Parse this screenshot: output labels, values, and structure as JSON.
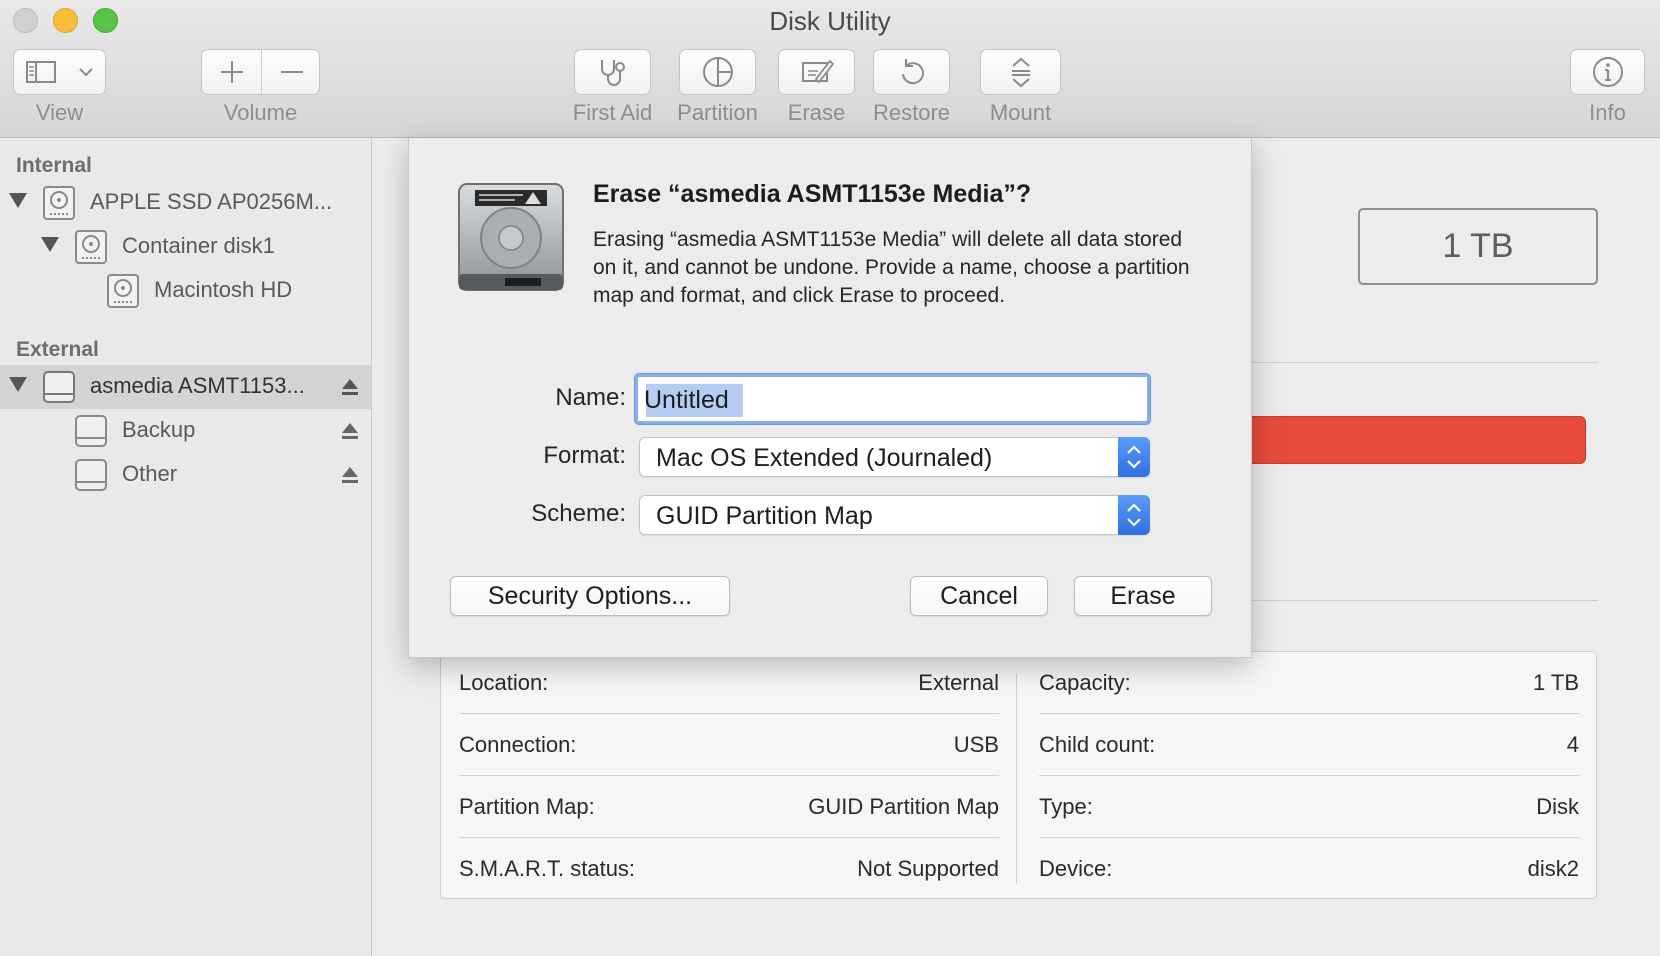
{
  "window": {
    "title": "Disk Utility"
  },
  "toolbar": {
    "view_label": "View",
    "volume_label": "Volume",
    "first_aid_label": "First Aid",
    "partition_label": "Partition",
    "erase_label": "Erase",
    "restore_label": "Restore",
    "mount_label": "Mount",
    "info_label": "Info"
  },
  "sidebar": {
    "internal_heading": "Internal",
    "external_heading": "External",
    "internal_items": [
      {
        "label": "APPLE SSD AP0256M...",
        "icon": "internal-disk-icon"
      },
      {
        "label": "Container disk1",
        "icon": "container-icon"
      },
      {
        "label": "Macintosh HD",
        "icon": "volume-icon"
      }
    ],
    "external_items": [
      {
        "label": "asmedia ASMT1153...",
        "icon": "external-disk-icon",
        "selected": true
      },
      {
        "label": "Backup",
        "icon": "external-volume-icon"
      },
      {
        "label": "Other",
        "icon": "external-volume-icon"
      }
    ]
  },
  "main": {
    "capacity_display": "1 TB",
    "usage_bar_color": "#e84b3c",
    "info": {
      "left": [
        {
          "key": "Location:",
          "value": "External"
        },
        {
          "key": "Connection:",
          "value": "USB"
        },
        {
          "key": "Partition Map:",
          "value": "GUID Partition Map"
        },
        {
          "key": "S.M.A.R.T. status:",
          "value": "Not Supported"
        }
      ],
      "right": [
        {
          "key": "Capacity:",
          "value": "1 TB"
        },
        {
          "key": "Child count:",
          "value": "4"
        },
        {
          "key": "Type:",
          "value": "Disk"
        },
        {
          "key": "Device:",
          "value": "disk2"
        }
      ]
    }
  },
  "dialog": {
    "title": "Erase “asmedia ASMT1153e Media”?",
    "message": "Erasing “asmedia ASMT1153e Media” will delete all data stored on it, and cannot be undone. Provide a name, choose a partition map and format, and click Erase to proceed.",
    "name_label": "Name:",
    "name_value": "Untitled",
    "format_label": "Format:",
    "format_value": "Mac OS Extended (Journaled)",
    "scheme_label": "Scheme:",
    "scheme_value": "GUID Partition Map",
    "security_button": "Security Options...",
    "cancel_button": "Cancel",
    "erase_button": "Erase"
  },
  "colors": {
    "accent": "#2f6fe0",
    "focus_ring": "#86aef0",
    "danger": "#e84b3c"
  }
}
